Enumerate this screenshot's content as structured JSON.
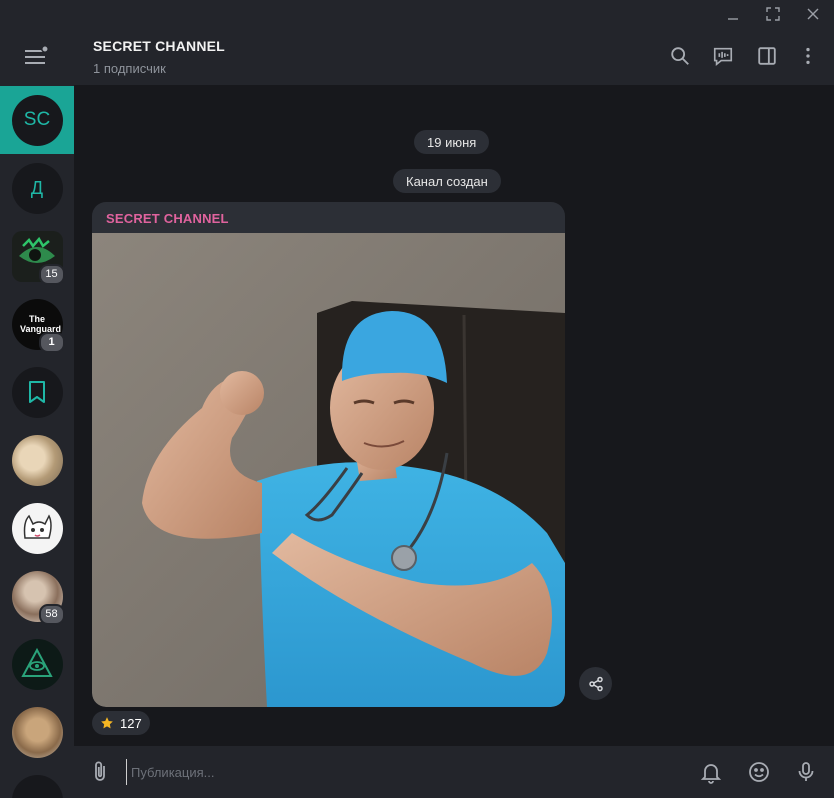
{
  "window": {
    "minimize_icon": "minimize-icon",
    "maximize_icon": "maximize-icon",
    "close_icon": "close-icon"
  },
  "header": {
    "title": "SECRET CHANNEL",
    "subtitle": "1 подписчик"
  },
  "sidebar": {
    "items": [
      {
        "initials": "SC",
        "active": true
      },
      {
        "initials": "Д"
      },
      {
        "badge": "15"
      },
      {
        "badge": "1",
        "logo_text": "The Vanguard"
      },
      {
        "icon": "bookmark-icon"
      },
      {},
      {},
      {
        "badge": "58"
      },
      {},
      {}
    ]
  },
  "chat": {
    "date": "19 июня",
    "service": "Канал создан",
    "message": {
      "author": "SECRET CHANNEL",
      "reaction_count": "127",
      "reaction_icon": "star-icon"
    }
  },
  "composer": {
    "placeholder": "Публикация..."
  },
  "colors": {
    "accent": "#1aa596",
    "author": "#e0639e",
    "panel": "#23252b",
    "background": "#17181c",
    "bubble": "#2c2f36"
  }
}
